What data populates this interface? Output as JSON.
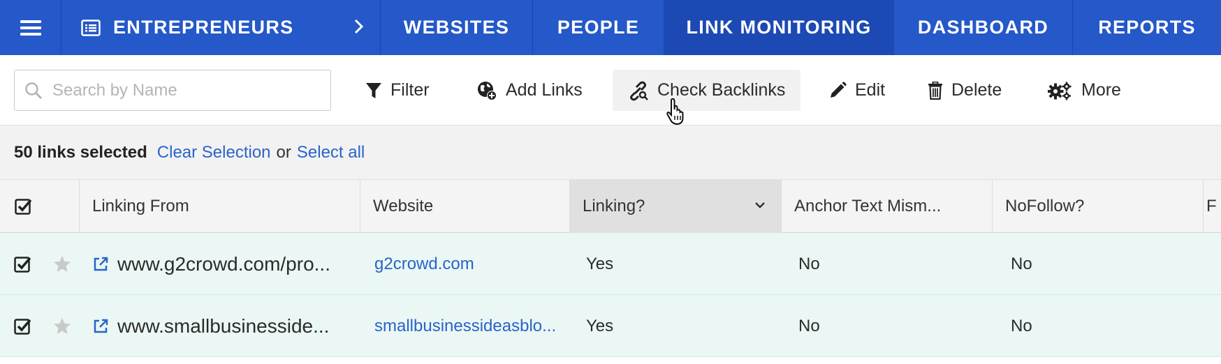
{
  "nav": {
    "project": "ENTREPRENEURS",
    "tabs": [
      {
        "label": "WEBSITES"
      },
      {
        "label": "PEOPLE"
      },
      {
        "label": "LINK MONITORING"
      },
      {
        "label": "DASHBOARD"
      },
      {
        "label": "REPORTS"
      }
    ],
    "active_tab": "LINK MONITORING"
  },
  "toolbar": {
    "search_placeholder": "Search by Name",
    "filter_label": "Filter",
    "add_links_label": "Add Links",
    "check_backlinks_label": "Check Backlinks",
    "edit_label": "Edit",
    "delete_label": "Delete",
    "more_label": "More"
  },
  "selection": {
    "count_text": "50 links selected",
    "clear_label": "Clear Selection",
    "or_text": "or",
    "select_all_label": "Select all"
  },
  "table": {
    "columns": [
      {
        "label": "Linking From"
      },
      {
        "label": "Website"
      },
      {
        "label": "Linking?"
      },
      {
        "label": "Anchor Text Mism..."
      },
      {
        "label": "NoFollow?"
      },
      {
        "label": "F"
      }
    ],
    "sorted_column": "Linking?",
    "rows": [
      {
        "linking_from": "www.g2crowd.com/pro...",
        "website": "g2crowd.com",
        "linking": "Yes",
        "anchor_mismatch": "No",
        "nofollow": "No",
        "checked": true
      },
      {
        "linking_from": "www.smallbusinesside...",
        "website": "smallbusinessideasblo...",
        "linking": "Yes",
        "anchor_mismatch": "No",
        "nofollow": "No",
        "checked": true
      }
    ]
  },
  "colors": {
    "nav_bg": "#2558c8",
    "nav_active": "#1c49b3",
    "link": "#2a63c9",
    "row_selected": "#eaf7f4"
  },
  "icons": {
    "menu": "hamburger-icon",
    "project": "list-icon",
    "filter": "filter-funnel-icon",
    "add_links": "globe-plus-icon",
    "check_backlinks": "chain-link-search-icon",
    "edit": "pencil-icon",
    "delete": "trash-icon",
    "more": "gears-icon",
    "external": "external-link-icon",
    "star": "star-icon"
  }
}
